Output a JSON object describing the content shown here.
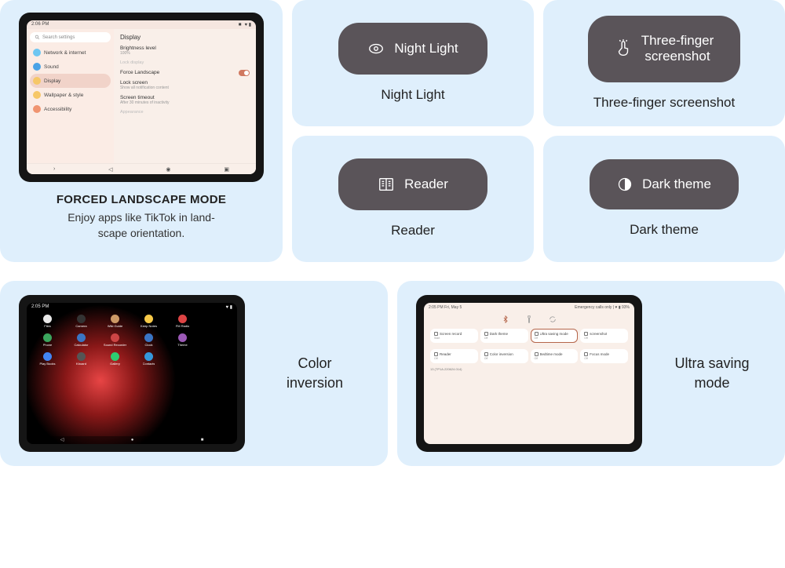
{
  "forced_landscape": {
    "title": "FORCED LANDSCAPE MODE",
    "description": "Enjoy apps like TikTok in land-\nscape orientation.",
    "statusbar_time": "2:06 PM",
    "search_placeholder": "Search settings",
    "sidebar": [
      {
        "label": "Network & internet",
        "color": "#6ec6f1"
      },
      {
        "label": "Sound",
        "color": "#4aa3e6"
      },
      {
        "label": "Display",
        "color": "#f6c768",
        "active": true
      },
      {
        "label": "Wallpaper & style",
        "color": "#f6c768"
      },
      {
        "label": "Accessibility",
        "color": "#f09470"
      }
    ],
    "panel": {
      "title": "Display",
      "rows": [
        {
          "label": "Brightness level",
          "sub": "100%"
        },
        {
          "label": "Lock display",
          "sub": "",
          "faded": true
        },
        {
          "label": "Force Landscape",
          "sub": "",
          "toggle": true
        },
        {
          "label": "Lock screen",
          "sub": "Show all notification content"
        },
        {
          "label": "Screen timeout",
          "sub": "After 30 minutes of inactivity"
        },
        {
          "label": "Appearance",
          "sub": "",
          "faded": true
        }
      ]
    }
  },
  "pills": [
    {
      "icon": "eye",
      "text": "Night Light",
      "label": "Night Light"
    },
    {
      "icon": "touch",
      "text": "Three-finger\nscreenshot",
      "label": "Three-finger screenshot"
    },
    {
      "icon": "reader",
      "text": "Reader",
      "label": "Reader"
    },
    {
      "icon": "dark",
      "text": "Dark theme",
      "label": "Dark theme"
    }
  ],
  "color_inversion": {
    "label": "Color\ninversion",
    "statusbar_time": "2:05 PM",
    "apps": [
      {
        "name": "Files",
        "color": "#e8e8e8"
      },
      {
        "name": "Camera",
        "color": "#333"
      },
      {
        "name": "Wiki Guide",
        "color": "#c96"
      },
      {
        "name": "Keep Notes",
        "color": "#f7c948"
      },
      {
        "name": "FM Radio",
        "color": "#d44"
      },
      {
        "name": "",
        "color": "transparent"
      },
      {
        "name": "Phone",
        "color": "#3ba55d"
      },
      {
        "name": "Calculator",
        "color": "#3a75c4"
      },
      {
        "name": "Sound Recorder",
        "color": "#c44"
      },
      {
        "name": "Clock",
        "color": "#3a75c4"
      },
      {
        "name": "Theme",
        "color": "#9b59b6"
      },
      {
        "name": "",
        "color": "transparent"
      },
      {
        "name": "Play Books",
        "color": "#4285f4"
      },
      {
        "name": "Kboard",
        "color": "#555"
      },
      {
        "name": "Gallery",
        "color": "#2ecc71"
      },
      {
        "name": "Contacts",
        "color": "#3498db"
      }
    ]
  },
  "ultra_saving": {
    "label": "Ultra saving\nmode",
    "statusbar_time": "2:05 PM Fri, May 5",
    "statusbar_right": "Emergency calls only | ♥ ▮ 93%",
    "tiles_row1": [
      {
        "label": "Screen record",
        "sub": "Start"
      },
      {
        "label": "Dark theme",
        "sub": "Off"
      },
      {
        "label": "Ultra saving mode",
        "sub": "Off",
        "active": true
      },
      {
        "label": "screenshot",
        "sub": "Off"
      }
    ],
    "tiles_row2": [
      {
        "label": "Reader",
        "sub": "Off"
      },
      {
        "label": "Color inversion",
        "sub": "Off"
      },
      {
        "label": "Bedtime mode",
        "sub": "Off"
      },
      {
        "label": "Focus mode",
        "sub": "Off"
      }
    ],
    "footer": "13 (TP1A.220624.014)"
  }
}
